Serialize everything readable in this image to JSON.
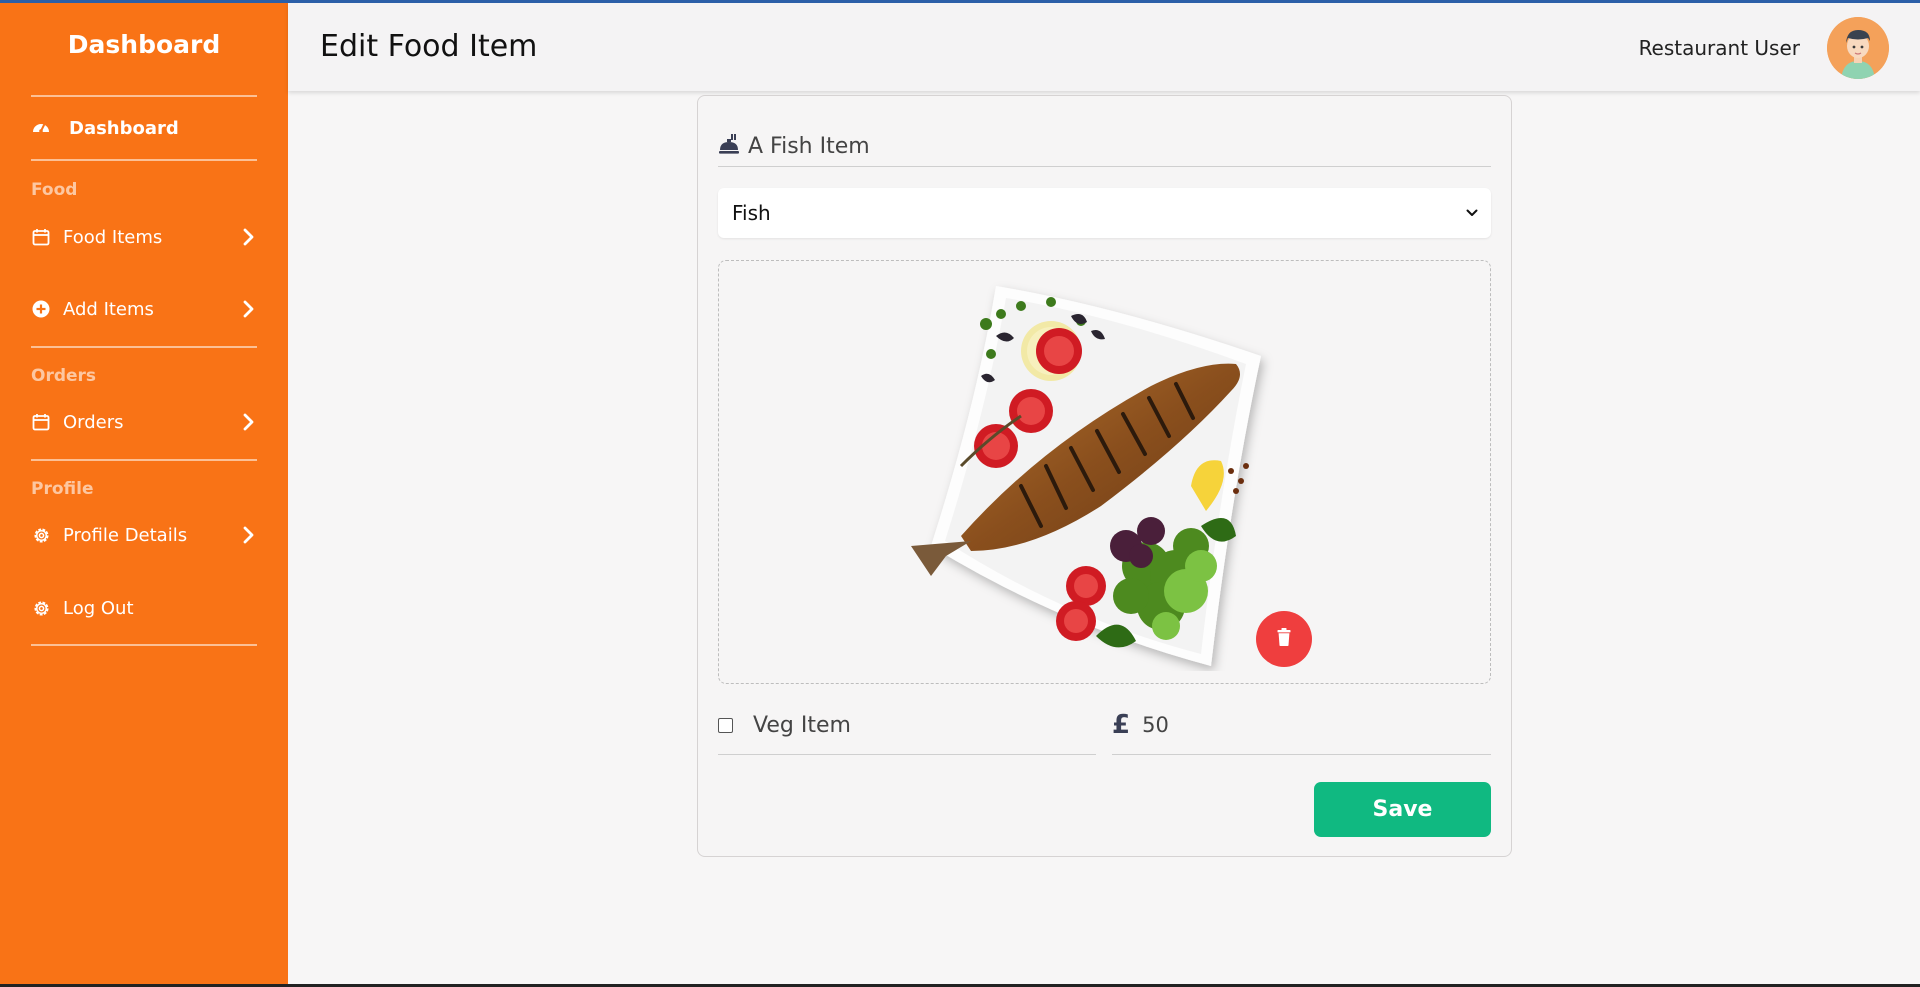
{
  "sidebar": {
    "brand": "Dashboard",
    "dashboard_link": "Dashboard",
    "sections": {
      "food": "Food",
      "orders": "Orders",
      "profile": "Profile"
    },
    "items": {
      "food_items": "Food Items",
      "add_items": "Add Items",
      "orders": "Orders",
      "profile_details": "Profile Details",
      "log_out": "Log Out"
    },
    "icons": [
      "speedometer-icon",
      "calendar-icon",
      "plus-circle-icon",
      "calendar-icon",
      "gear-icon",
      "gear-icon",
      "chevron-right-icon"
    ]
  },
  "header": {
    "title": "Edit Food Item",
    "user_name": "Restaurant User",
    "avatar_icon": "user-avatar-icon"
  },
  "form": {
    "item_title": "A Fish Item",
    "title_icon": "food-service-icon",
    "category_selected": "Fish",
    "image_alt": "grilled-fish-plate-image",
    "delete_icon": "trash-icon",
    "veg_label": "Veg Item",
    "veg_checked": false,
    "currency_symbol": "£",
    "price": "50",
    "save_label": "Save"
  },
  "colors": {
    "sidebar": "#f97316",
    "save": "#10b981",
    "delete": "#ef3e3e",
    "header_bg": "#f4f3f4",
    "accent_line": "#2b5fa8"
  }
}
